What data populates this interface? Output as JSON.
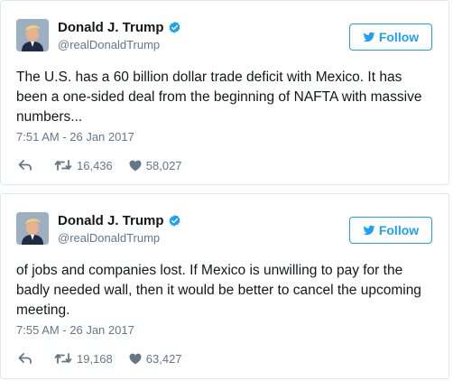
{
  "tweets": [
    {
      "author_name": "Donald J. Trump",
      "handle": "@realDonaldTrump",
      "follow_label": "Follow",
      "text": "The U.S. has a 60 billion dollar trade deficit with Mexico. It has been a one-sided deal from the beginning of NAFTA with massive numbers...",
      "timestamp": "7:51 AM - 26 Jan 2017",
      "retweets": "16,436",
      "likes": "58,027"
    },
    {
      "author_name": "Donald J. Trump",
      "handle": "@realDonaldTrump",
      "follow_label": "Follow",
      "text": "of jobs and companies lost. If Mexico is unwilling to pay for the badly needed wall, then it would be better to cancel the upcoming meeting.",
      "timestamp": "7:55 AM - 26 Jan 2017",
      "retweets": "19,168",
      "likes": "63,427"
    }
  ],
  "colors": {
    "brand": "#1da1f2",
    "text": "#14171a",
    "muted": "#657786",
    "border": "#e1e8ed"
  },
  "icons": {
    "verified": "verified-badge-icon",
    "follow": "bird-icon",
    "reply": "reply-icon",
    "retweet": "retweet-icon",
    "like": "heart-icon"
  }
}
